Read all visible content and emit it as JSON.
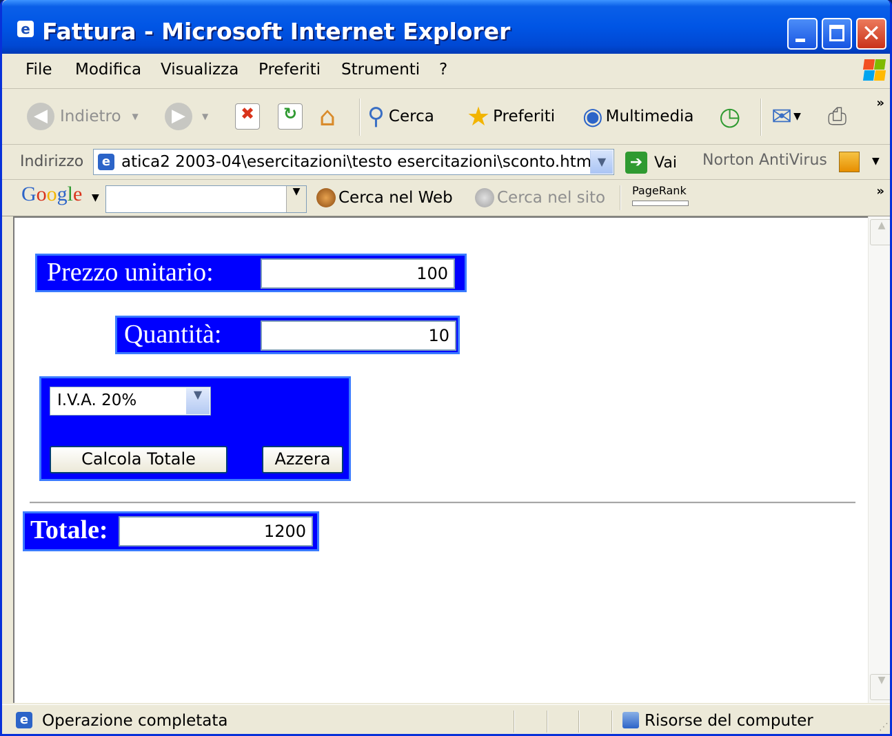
{
  "window": {
    "title": "Fattura - Microsoft Internet Explorer"
  },
  "menu": [
    "File",
    "Modifica",
    "Visualizza",
    "Preferiti",
    "Strumenti",
    "?"
  ],
  "toolbar": {
    "back_label": "Indietro",
    "search_label": "Cerca",
    "favorites_label": "Preferiti",
    "media_label": "Multimedia"
  },
  "address": {
    "label": "Indirizzo",
    "value": "atica2 2003-04\\esercitazioni\\testo esercitazioni\\sconto.htm",
    "go_label": "Vai",
    "norton_label": "Norton AntiVirus"
  },
  "google_bar": {
    "logo_text": "Google",
    "search_value": "",
    "search_web_label": "Cerca nel Web",
    "search_site_label": "Cerca nel sito",
    "pagerank_label": "PageRank"
  },
  "form": {
    "unit_price_label": "Prezzo unitario:",
    "unit_price_value": "100",
    "quantity_label": "Quantità:",
    "quantity_value": "10",
    "vat_selected": "I.V.A. 20%",
    "calc_button": "Calcola Totale",
    "reset_button": "Azzera",
    "total_label": "Totale:",
    "total_value": "1200"
  },
  "status": {
    "text": "Operazione completata",
    "zone": "Risorse del computer"
  },
  "colors": {
    "form_panel": "#0000ff",
    "titlebar": "#0055e5"
  }
}
